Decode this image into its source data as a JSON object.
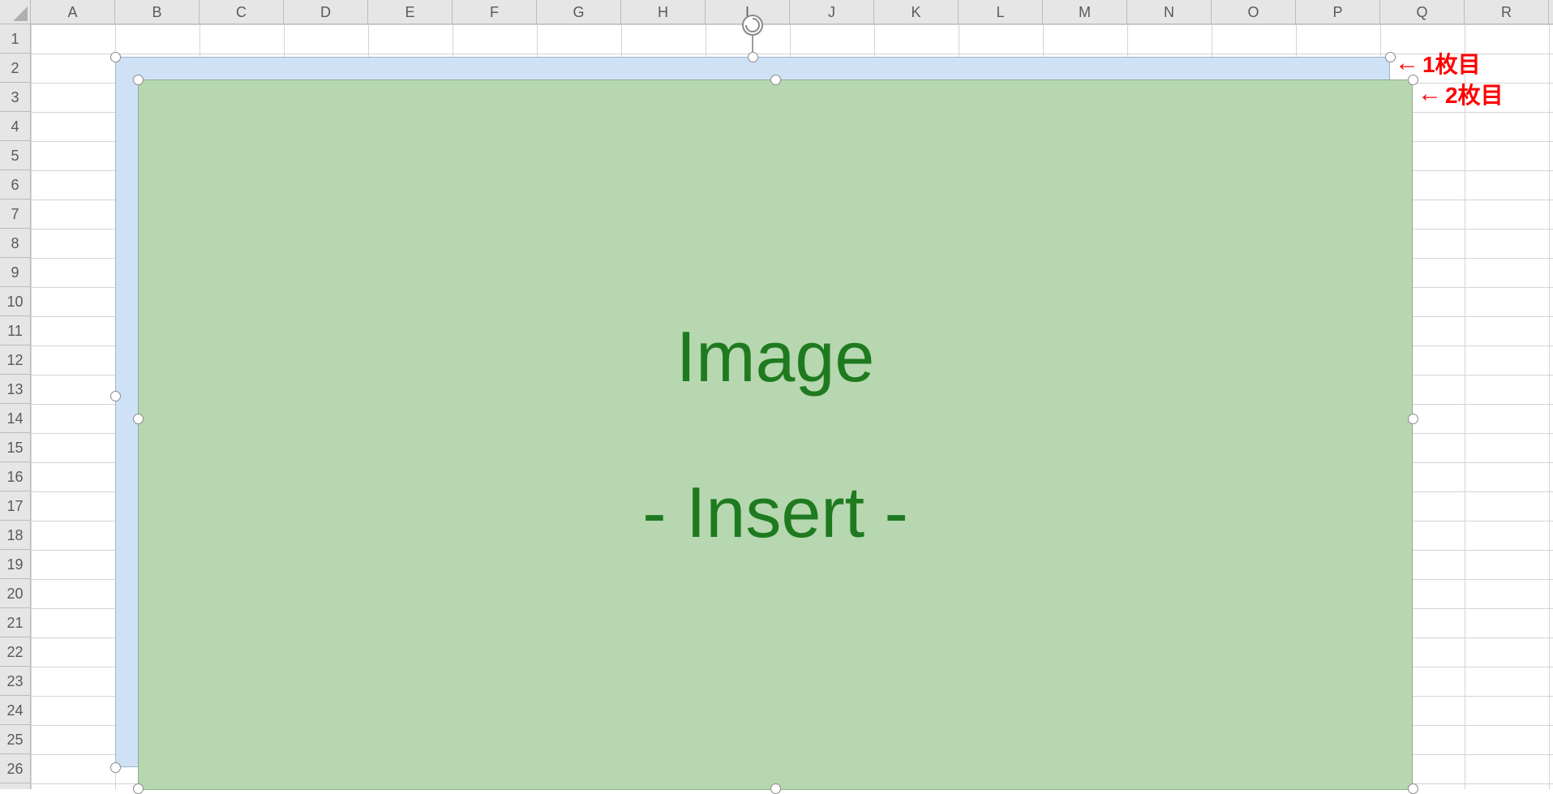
{
  "grid": {
    "columns": [
      "A",
      "B",
      "C",
      "D",
      "E",
      "F",
      "G",
      "H",
      "I",
      "J",
      "K",
      "L",
      "M",
      "N",
      "O",
      "P",
      "Q",
      "R"
    ],
    "rows": [
      "1",
      "2",
      "3",
      "4",
      "5",
      "6",
      "7",
      "8",
      "9",
      "10",
      "11",
      "12",
      "13",
      "14",
      "15",
      "16",
      "17",
      "18",
      "19",
      "20",
      "21",
      "22",
      "23",
      "24",
      "25",
      "26"
    ]
  },
  "shapes": {
    "image1": {
      "label_line1": "",
      "label_line2": ""
    },
    "image2": {
      "label_line1": "Image",
      "label_line2": "- Insert -"
    }
  },
  "annotations": {
    "first": {
      "arrow": "←",
      "text": "1枚目"
    },
    "second": {
      "arrow": "←",
      "text": "2枚目"
    }
  }
}
